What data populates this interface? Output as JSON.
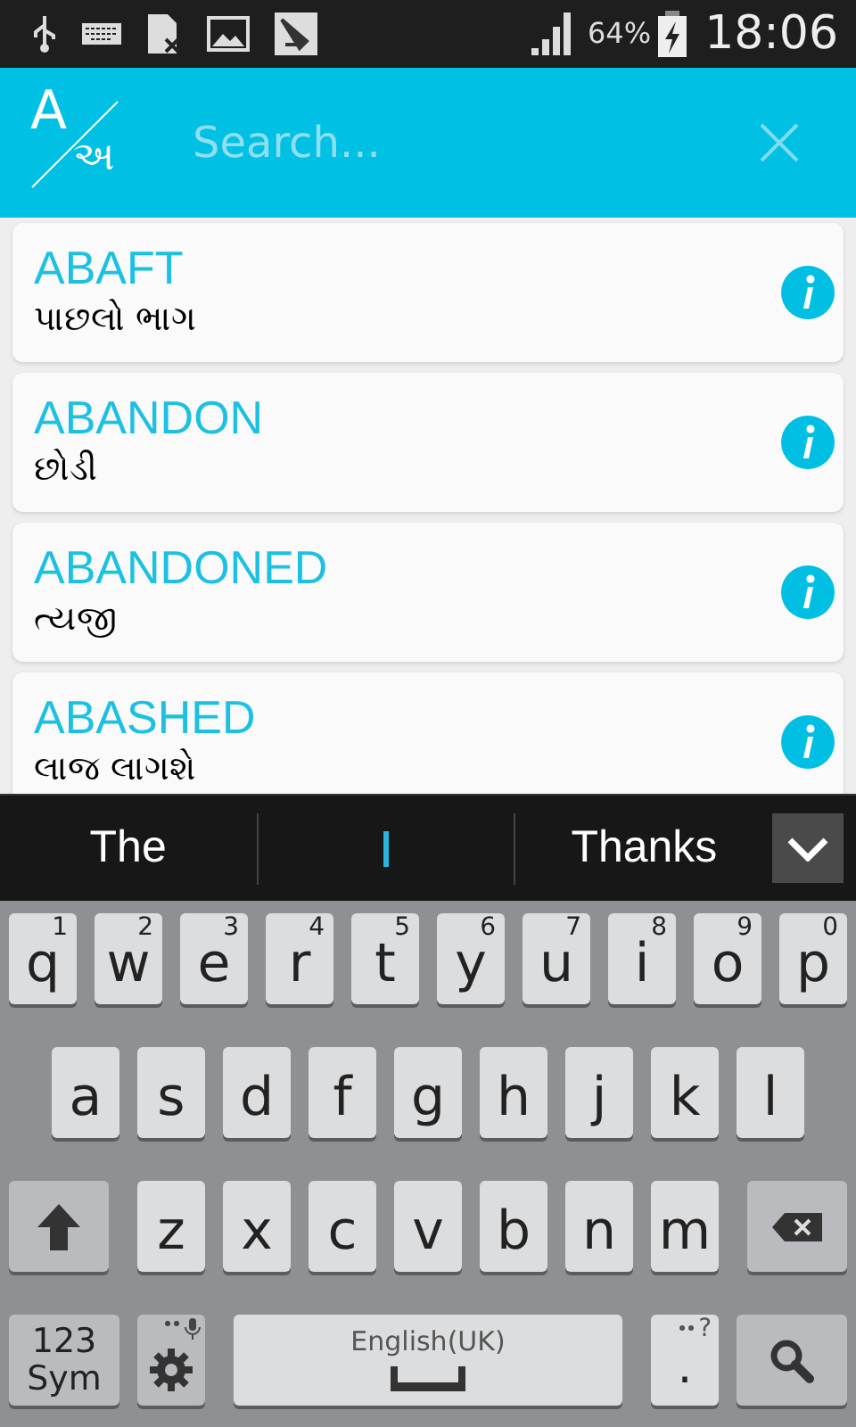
{
  "status_bar": {
    "battery": "64%",
    "time": "18:06"
  },
  "app_bar": {
    "logo": {
      "latin": "A",
      "gujarati": "અ"
    },
    "search": {
      "placeholder": "Search..."
    }
  },
  "entries": [
    {
      "word": "ABAFT",
      "meaning": "પાછલો ભાગ"
    },
    {
      "word": "ABANDON",
      "meaning": "છોડી"
    },
    {
      "word": "ABANDONED",
      "meaning": "ત્યજી"
    },
    {
      "word": "ABASHED",
      "meaning": "લાજ લાગશે"
    }
  ],
  "suggestions": [
    {
      "kind": "word",
      "text": "The"
    },
    {
      "kind": "cursor"
    },
    {
      "kind": "word",
      "text": "Thanks"
    }
  ],
  "keyboard": {
    "top_keys": [
      {
        "kind": "letter",
        "label": "q",
        "hint": "1"
      },
      {
        "kind": "letter",
        "label": "w",
        "hint": "2"
      },
      {
        "kind": "letter",
        "label": "e",
        "hint": "3"
      },
      {
        "kind": "letter",
        "label": "r",
        "hint": "4"
      },
      {
        "kind": "letter",
        "label": "t",
        "hint": "5"
      },
      {
        "kind": "letter",
        "label": "y",
        "hint": "6"
      },
      {
        "kind": "letter",
        "label": "u",
        "hint": "7"
      },
      {
        "kind": "letter",
        "label": "i",
        "hint": "8"
      },
      {
        "kind": "letter",
        "label": "o",
        "hint": "9"
      },
      {
        "kind": "letter",
        "label": "p",
        "hint": "0"
      }
    ],
    "middle_keys": [
      {
        "kind": "letter",
        "label": "a"
      },
      {
        "kind": "letter",
        "label": "s"
      },
      {
        "kind": "letter",
        "label": "d"
      },
      {
        "kind": "letter",
        "label": "f"
      },
      {
        "kind": "letter",
        "label": "g"
      },
      {
        "kind": "letter",
        "label": "h"
      },
      {
        "kind": "letter",
        "label": "j"
      },
      {
        "kind": "letter",
        "label": "k"
      },
      {
        "kind": "letter",
        "label": "l"
      }
    ],
    "lower_keys": [
      {
        "kind": "shift"
      },
      {
        "kind": "letter",
        "label": "z"
      },
      {
        "kind": "letter",
        "label": "x"
      },
      {
        "kind": "letter",
        "label": "c"
      },
      {
        "kind": "letter",
        "label": "v"
      },
      {
        "kind": "letter",
        "label": "b"
      },
      {
        "kind": "letter",
        "label": "n"
      },
      {
        "kind": "letter",
        "label": "m"
      },
      {
        "kind": "backspace"
      }
    ],
    "function_keys": [
      {
        "kind": "symbols",
        "label": "123",
        "label2": "Sym"
      },
      {
        "kind": "settings"
      },
      {
        "kind": "space",
        "label": "English(UK)"
      },
      {
        "kind": "period",
        "label": ".",
        "hint": "?"
      },
      {
        "kind": "search"
      }
    ]
  }
}
